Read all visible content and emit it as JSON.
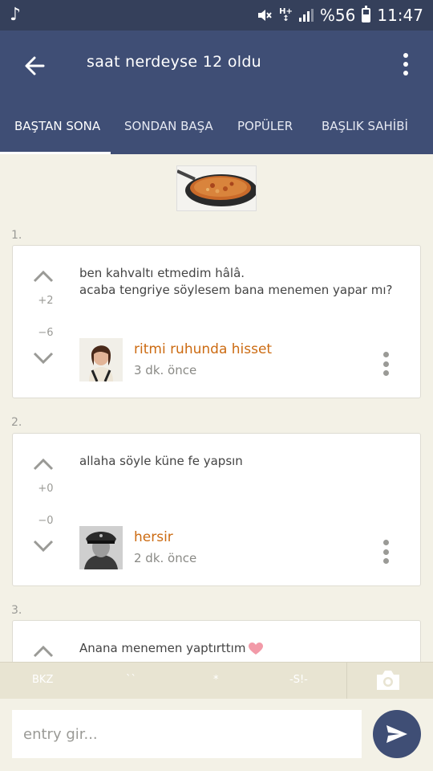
{
  "status_bar": {
    "battery": "%56",
    "time": "11:47"
  },
  "header": {
    "title": "saat nerdeyse 12 oldu"
  },
  "tabs": [
    {
      "label": "BAŞTAN SONA",
      "active": true
    },
    {
      "label": "SONDAN BAŞA",
      "active": false
    },
    {
      "label": "POPÜLER",
      "active": false
    },
    {
      "label": "BAŞLIK SAHİBİ",
      "active": false
    }
  ],
  "entries": [
    {
      "index": "1.",
      "lines": [
        "ben kahvaltı etmedim hâlâ.",
        "acaba tengriye söylesem bana menemen yapar mı?"
      ],
      "up_score": "+2",
      "down_score": "−6",
      "author": "ritmi ruhunda hisset",
      "time": "3 dk. önce"
    },
    {
      "index": "2.",
      "lines": [
        "allaha söyle küne fe yapsın"
      ],
      "up_score": "+0",
      "down_score": "−0",
      "author": "hersir",
      "time": "2 dk. önce"
    },
    {
      "index": "3.",
      "lines": [
        "Anana menemen yaptırttım"
      ]
    }
  ],
  "toolbar": {
    "bkz": "BKZ",
    "backticks": "``",
    "star": "*",
    "spoiler": "-S!-"
  },
  "composer": {
    "placeholder": "entry gir..."
  },
  "colors": {
    "primary": "#3f4e75",
    "status_bar": "#35405b",
    "author": "#cc6b12",
    "background": "#f3f1e6"
  }
}
